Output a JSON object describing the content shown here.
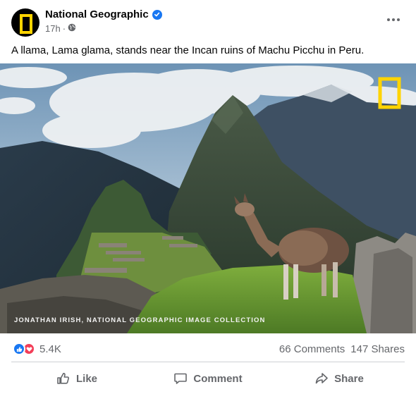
{
  "post": {
    "page_name": "National Geographic",
    "timestamp": "17h",
    "separator": "·",
    "audience_icon": "globe-icon",
    "more_icon": "more-options-icon",
    "caption": "A llama, Lama glama, stands near the Incan ruins of Machu Picchu in Peru.",
    "photo": {
      "credit": "JONATHAN IRISH, NATIONAL GEOGRAPHIC IMAGE COLLECTION",
      "logo": "yellow-frame-logo"
    }
  },
  "stats": {
    "reaction_icons": [
      "like-reaction-icon",
      "love-reaction-icon"
    ],
    "reaction_count": "5.4K",
    "comments": "66 Comments",
    "shares": "147 Shares"
  },
  "actions": {
    "like": "Like",
    "comment": "Comment",
    "share": "Share"
  },
  "colors": {
    "brand_yellow": "#ffd400",
    "facebook_blue": "#1877f2",
    "love_red": "#f33e58",
    "secondary_text": "#65676b"
  }
}
